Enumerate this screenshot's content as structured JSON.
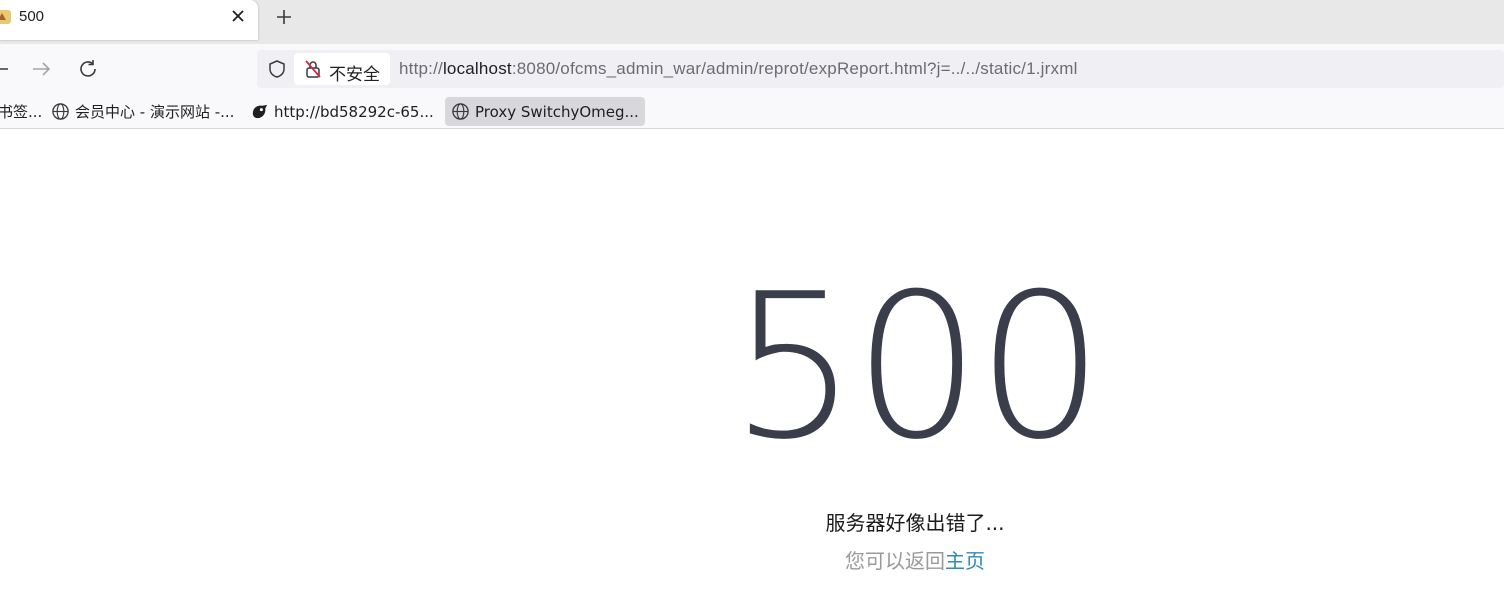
{
  "tab": {
    "title": "500",
    "favicon": "cat-favicon-icon",
    "close": "close-icon",
    "new_tab": "plus-icon"
  },
  "toolbar": {
    "back": "back-arrow-icon",
    "forward": "forward-arrow-icon",
    "reload": "reload-icon",
    "security_label": "不安全",
    "url_prefix": "http://",
    "url_host": "localhost",
    "url_rest": ":8080/ofcms_admin_war/admin/reprot/expReport.html?j=../../static/1.jrxml"
  },
  "bookmarks": [
    {
      "label": "书签...",
      "icon": "none"
    },
    {
      "label": "会员中心 - 演示网站 -...",
      "icon": "globe-icon"
    },
    {
      "label": "http://bd58292c-65...",
      "icon": "bird-icon"
    },
    {
      "label": "Proxy SwitchyOmeg...",
      "icon": "globe-icon"
    }
  ],
  "page": {
    "code": "500",
    "message": "服务器好像出错了...",
    "sub_prefix": "您可以返回",
    "home_link": "主页"
  },
  "colors": {
    "code": "#3a3d4a",
    "link": "#2e8ab8",
    "muted": "#9a9a9a"
  }
}
